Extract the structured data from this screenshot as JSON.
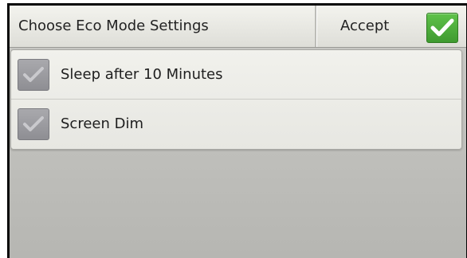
{
  "header": {
    "title": "Choose Eco Mode Settings",
    "accept_label": "Accept",
    "accept_icon": "check-icon",
    "accept_color": "#4CAF3A"
  },
  "options": [
    {
      "label": "Sleep after 10 Minutes",
      "checked": true,
      "icon": "check-icon"
    },
    {
      "label": "Screen Dim",
      "checked": true,
      "icon": "check-icon"
    }
  ],
  "colors": {
    "checkbox_gray": "#9A9AA0",
    "accept_green": "#4CAF3A"
  }
}
